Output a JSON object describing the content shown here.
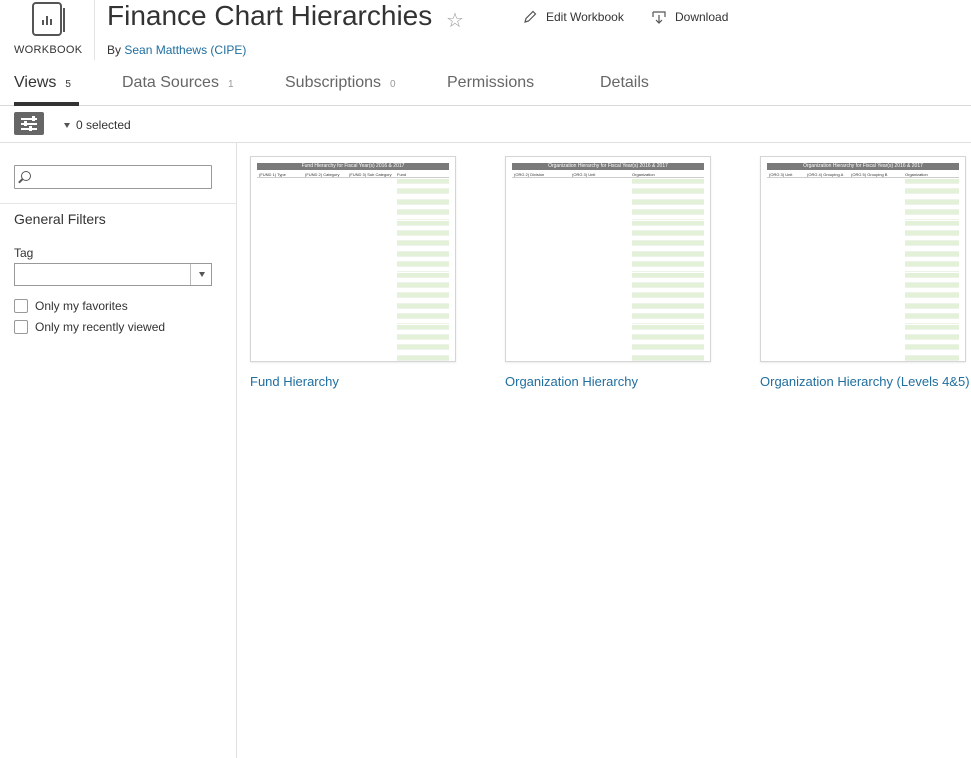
{
  "header": {
    "workbook_label": "WORKBOOK",
    "title": "Finance Chart Hierarchies",
    "byline_prefix": "By",
    "author": "Sean Matthews (CIPE)",
    "edit_label": "Edit Workbook",
    "download_label": "Download"
  },
  "tabs": [
    {
      "label": "Views",
      "count": "5",
      "active": true
    },
    {
      "label": "Data Sources",
      "count": "1",
      "active": false
    },
    {
      "label": "Subscriptions",
      "count": "0",
      "active": false
    },
    {
      "label": "Permissions",
      "count": "",
      "active": false
    },
    {
      "label": "Details",
      "count": "",
      "active": false
    }
  ],
  "toolbar": {
    "selected_text": "0 selected"
  },
  "sidebar": {
    "search_placeholder": "",
    "general_filters_title": "General Filters",
    "tag_label": "Tag",
    "tag_value": "",
    "only_favorites": "Only my favorites",
    "only_recent": "Only my recently viewed"
  },
  "views": [
    {
      "label": "Fund Hierarchy",
      "thumb_title": "Fund Hierarchy for Fiscal Year(s) 2016 & 2017",
      "columns": [
        "(FUND 1) Type",
        "(FUND 2) Category",
        "(FUND 3) Sub Category",
        "Fund"
      ]
    },
    {
      "label": "Organization Hierarchy",
      "thumb_title": "Organization Hierarchy for Fiscal Year(s) 2016 & 2017",
      "columns": [
        "(ORG 2) Division",
        "(ORG 3) Unit",
        "Organization"
      ]
    },
    {
      "label": "Organization Hierarchy (Levels 4&5)",
      "thumb_title": "Organization Hierarchy for Fiscal Year(s) 2016 & 2017",
      "columns": [
        "(ORG 3) Unit",
        "(ORG 4) Grouping A",
        "(ORG 5) Grouping B",
        "Organization"
      ]
    }
  ],
  "colors": {
    "link": "#1f6e9f",
    "text": "#333333",
    "thumb_header": "#7a7a7a",
    "thumb_row_green": "#e4f1d9"
  }
}
